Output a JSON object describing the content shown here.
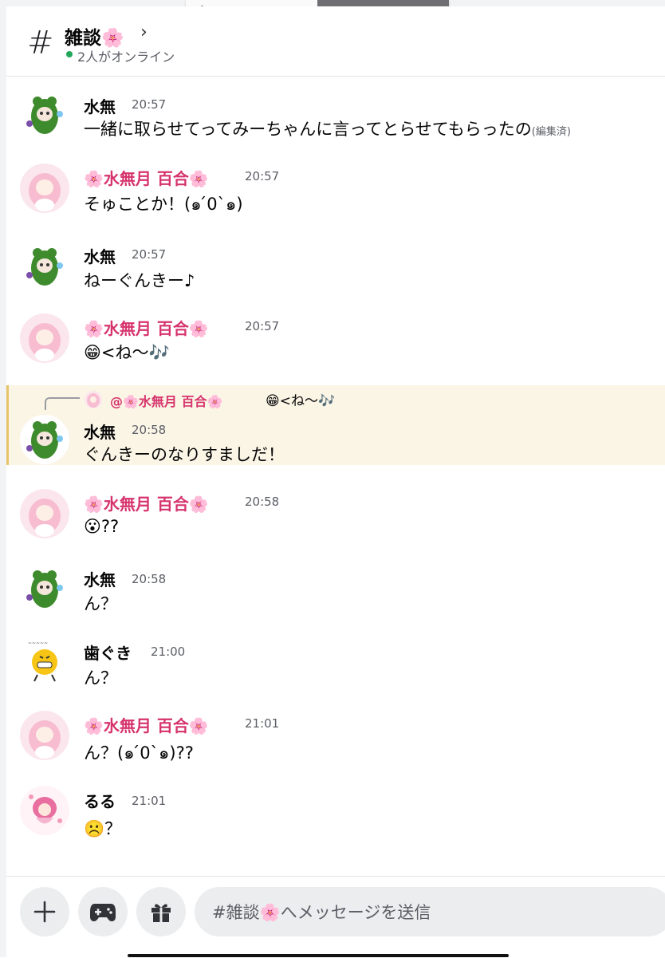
{
  "channel": {
    "title": "雑談🌸",
    "online": "2人がオンライン"
  },
  "messages": [
    {
      "author": "水無",
      "time": "20:57",
      "text": "一緒に取らせてってみーちゃんに言ってとらせてもらったの",
      "edited": "(編集済)"
    },
    {
      "author": "🌸水無月 百合🌸",
      "time": "20:57",
      "text": "そゅことか！(๑ ́0`๑)"
    },
    {
      "author": "水無",
      "time": "20:57",
      "text": "ねーぐんきー♪"
    },
    {
      "author": "🌸水無月 百合🌸",
      "time": "20:57",
      "text": "😁<ね〜🎶"
    },
    {
      "author": "水無",
      "time": "20:58",
      "text": "ぐんきーのなりすましだ！",
      "reply": {
        "author": "@🌸水無月 百合🌸",
        "text": "😁<ね〜🎶"
      }
    },
    {
      "author": "🌸水無月 百合🌸",
      "time": "20:58",
      "text": "😮??"
    },
    {
      "author": "水無",
      "time": "20:58",
      "text": "ん？"
    },
    {
      "author": "歯ぐき",
      "time": "21:00",
      "text": "ん？"
    },
    {
      "author": "🌸水無月 百合🌸",
      "time": "21:01",
      "text": "ん？(๑ ́0`๑)??"
    },
    {
      "author": "るる",
      "time": "21:01",
      "text": "☹️？"
    }
  ],
  "composer": {
    "placeholder": "#雑談🌸へメッセージを送信"
  },
  "colors": {
    "accent_pink": "#d6336c",
    "online_green": "#23a55a",
    "reply_highlight": "#fbf5e6"
  }
}
